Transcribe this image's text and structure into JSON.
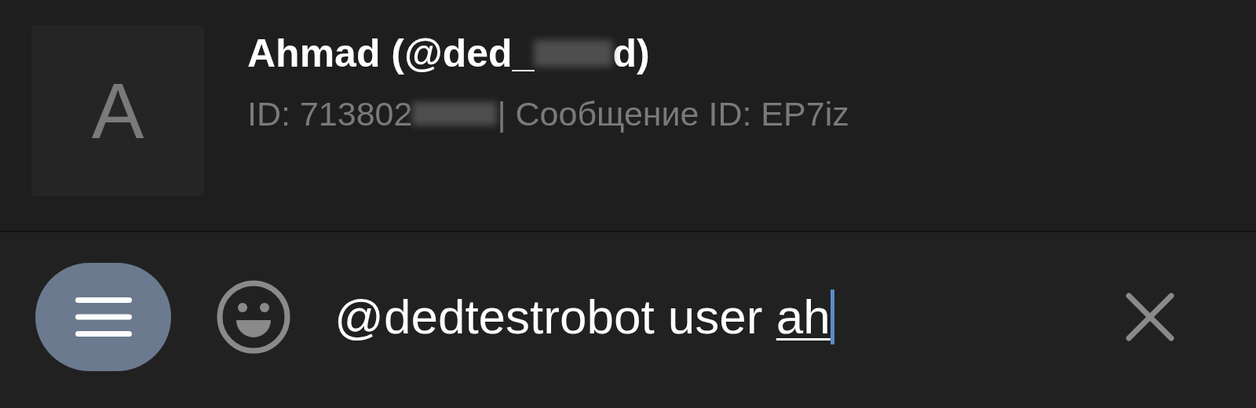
{
  "result": {
    "avatar_letter": "A",
    "title_start": "Ahmad (@ded_",
    "title_end": "d)",
    "subtitle_start": "ID: 713802",
    "subtitle_end": " | Сообщение ID: EP7iz"
  },
  "composer": {
    "text": "@dedtestrobot user",
    "composing_word": "ah"
  }
}
